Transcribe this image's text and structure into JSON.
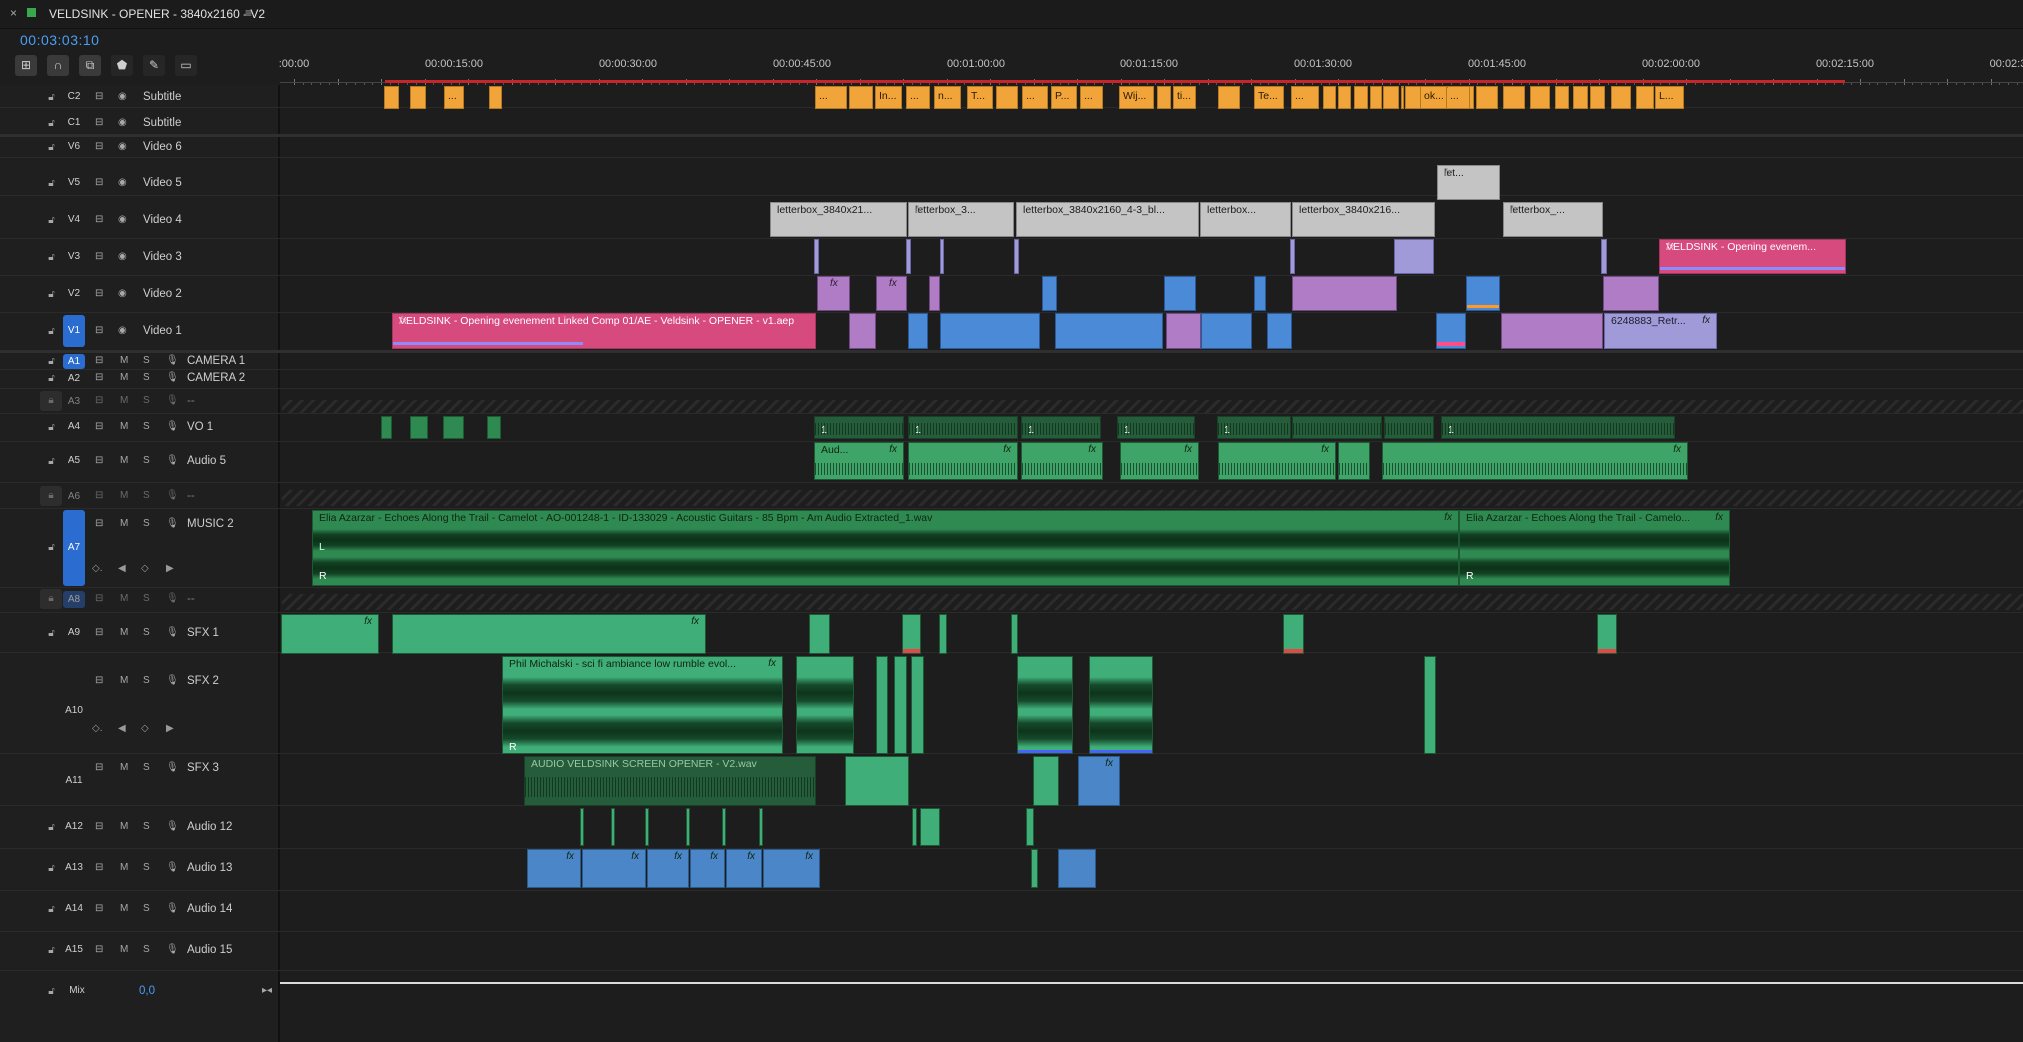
{
  "window": {
    "title": "VELDSINK - OPENER - 3840x2160 - V2",
    "close_glyph": "×",
    "menu_glyph": "≡"
  },
  "timecode": "00:03:03:10",
  "toolbar": {
    "icons": [
      "insert-overwrite-icon",
      "snap-icon",
      "linked-selection-icon",
      "marker-icon",
      "wrench-icon",
      "captions-icon"
    ]
  },
  "ruler": {
    "labels": [
      ":00:00",
      "00:00:15:00",
      "00:00:30:00",
      "00:00:45:00",
      "00:01:00:00",
      "00:01:15:00",
      "00:01:30:00",
      "00:01:45:00",
      "00:02:00:00",
      "00:02:15:00",
      "00:02:3"
    ]
  },
  "tracks": {
    "C2": {
      "id": "C2",
      "name": "Subtitle"
    },
    "C1": {
      "id": "C1",
      "name": "Subtitle"
    },
    "V6": {
      "id": "V6",
      "name": "Video 6"
    },
    "V5": {
      "id": "V5",
      "name": "Video 5"
    },
    "V4": {
      "id": "V4",
      "name": "Video 4"
    },
    "V3": {
      "id": "V3",
      "name": "Video 3"
    },
    "V2": {
      "id": "V2",
      "name": "Video 2"
    },
    "V1": {
      "id": "V1",
      "name": "Video 1"
    },
    "A1": {
      "id": "A1",
      "name": "CAMERA 1"
    },
    "A2": {
      "id": "A2",
      "name": "CAMERA 2"
    },
    "A3": {
      "id": "A3",
      "name": "--"
    },
    "A4": {
      "id": "A4",
      "name": "VO 1"
    },
    "A5": {
      "id": "A5",
      "name": "Audio 5"
    },
    "A6": {
      "id": "A6",
      "name": "--"
    },
    "A7": {
      "id": "A7",
      "name": "MUSIC 2"
    },
    "A8": {
      "id": "A8",
      "name": "--"
    },
    "A9": {
      "id": "A9",
      "name": "SFX 1"
    },
    "A10": {
      "id": "A10",
      "name": "SFX 2"
    },
    "A11": {
      "id": "A11",
      "name": "SFX 3"
    },
    "A12": {
      "id": "A12",
      "name": "Audio 12"
    },
    "A13": {
      "id": "A13",
      "name": "Audio 13"
    },
    "A14": {
      "id": "A14",
      "name": "Audio 14"
    },
    "A15": {
      "id": "A15",
      "name": "Audio 15"
    },
    "Mix": {
      "id": "Mix",
      "name": "0,0"
    }
  },
  "track_controls": {
    "mute": "M",
    "solo": "S"
  },
  "clips": {
    "subtitles": [
      "In...",
      "n...",
      "T...",
      "P...",
      "Wij...",
      "ti...",
      "Te...",
      "ok...",
      "L..."
    ],
    "subtitle_dots": "...",
    "v5": "let...",
    "v4": [
      "letterbox_3840x21...",
      "letterbox_3...",
      "letterbox_3840x2160_4-3_bl...",
      "letterbox...",
      "letterbox_3840x216...",
      "letterbox_..."
    ],
    "v3_pink": "VELDSINK - Opening evenem...",
    "v1_pink": "VELDSINK - Opening evenement Linked Comp 01/AE - Veldsink - OPENER - v1.aep",
    "v1_end": "6248883_Retr...",
    "a5_first": "Aud...",
    "music": [
      "Elia Azarzar - Echoes Along the Trail - Camelot - AO-001248-1 - ID-133029 - Acoustic Guitars - 85 Bpm - Am Audio Extracted_1.wav",
      "Elia Azarzar - Echoes Along the Trail - Camelo..."
    ],
    "sfx2": "Phil Michalski - sci fi ambiance low rumble evol...",
    "sfx3": "AUDIO VELDSINK SCREEN OPENER - V2.wav",
    "fx": "fx",
    "channel_L": "L",
    "channel_R": "R",
    "one": "1"
  },
  "colors": {
    "subtitle": "#f0a43a",
    "adjustment": "#c4c4c4",
    "pink": "#d64a7d",
    "purple": "#b07cc6",
    "blue": "#4a8ad6",
    "audio_green": "#2f8a52",
    "timecode": "#4a9ef5",
    "work_area": "#c8252b"
  }
}
